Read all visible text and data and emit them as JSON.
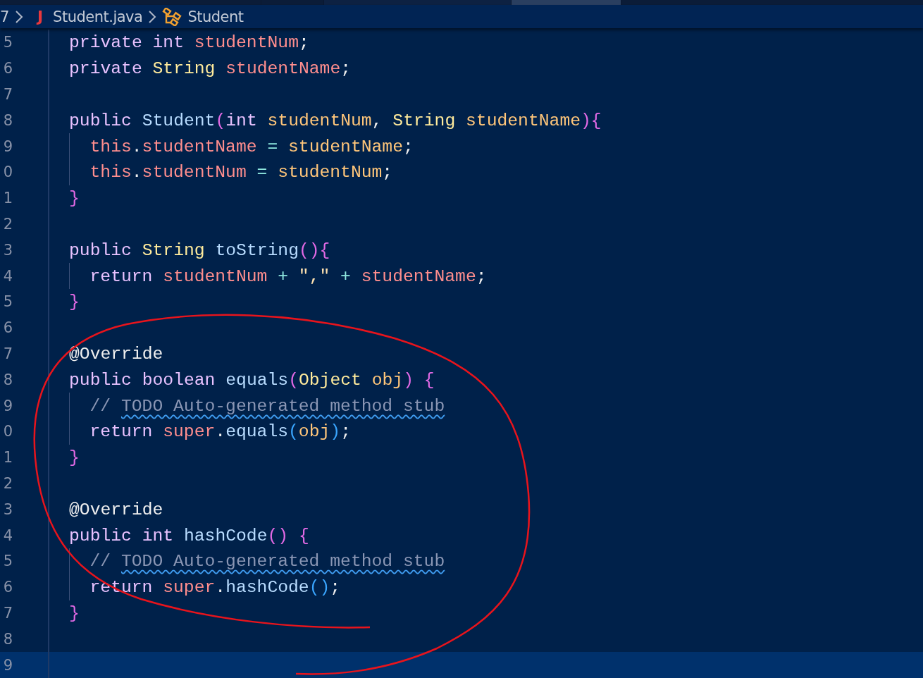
{
  "breadcrumb": {
    "folder": "7",
    "file_badge": "J",
    "file": "Student.java",
    "symbol": "Student"
  },
  "lines": [
    {
      "number": "5",
      "nested": false,
      "current": false,
      "tokens": [
        {
          "kind": "keyword",
          "text": "private "
        },
        {
          "kind": "keyword",
          "text": "int "
        },
        {
          "kind": "field",
          "text": "studentNum"
        },
        {
          "kind": "punct",
          "text": ";"
        }
      ]
    },
    {
      "number": "6",
      "nested": false,
      "current": false,
      "tokens": [
        {
          "kind": "keyword",
          "text": "private "
        },
        {
          "kind": "type",
          "text": "String "
        },
        {
          "kind": "field",
          "text": "studentName"
        },
        {
          "kind": "punct",
          "text": ";"
        }
      ]
    },
    {
      "number": "7",
      "nested": false,
      "current": false
    },
    {
      "number": "8",
      "nested": false,
      "current": false,
      "tokens": [
        {
          "kind": "keyword",
          "text": "public "
        },
        {
          "kind": "method",
          "text": "Student"
        },
        {
          "kind": "bracket",
          "text": "("
        },
        {
          "kind": "keyword",
          "text": "int "
        },
        {
          "kind": "param",
          "text": "studentNum"
        },
        {
          "kind": "punct",
          "text": ", "
        },
        {
          "kind": "type",
          "text": "String "
        },
        {
          "kind": "param",
          "text": "studentName"
        },
        {
          "kind": "bracket",
          "text": "){"
        }
      ]
    },
    {
      "number": "9",
      "nested": true,
      "current": false,
      "tokens": [
        {
          "kind": "this",
          "text": "this"
        },
        {
          "kind": "punct",
          "text": "."
        },
        {
          "kind": "field",
          "text": "studentName"
        },
        {
          "kind": "operator",
          "text": " = "
        },
        {
          "kind": "param",
          "text": "studentName"
        },
        {
          "kind": "punct",
          "text": ";"
        }
      ]
    },
    {
      "number": "0",
      "nested": true,
      "current": false,
      "tokens": [
        {
          "kind": "this",
          "text": "this"
        },
        {
          "kind": "punct",
          "text": "."
        },
        {
          "kind": "field",
          "text": "studentNum"
        },
        {
          "kind": "operator",
          "text": " = "
        },
        {
          "kind": "param",
          "text": "studentNum"
        },
        {
          "kind": "punct",
          "text": ";"
        }
      ]
    },
    {
      "number": "1",
      "nested": false,
      "current": false,
      "tokens": [
        {
          "kind": "bracket",
          "text": "}"
        }
      ]
    },
    {
      "number": "2",
      "nested": false,
      "current": false
    },
    {
      "number": "3",
      "nested": false,
      "current": false,
      "tokens": [
        {
          "kind": "keyword",
          "text": "public "
        },
        {
          "kind": "type",
          "text": "String "
        },
        {
          "kind": "method",
          "text": "toString"
        },
        {
          "kind": "bracket",
          "text": "(){"
        }
      ]
    },
    {
      "number": "4",
      "nested": true,
      "current": false,
      "tokens": [
        {
          "kind": "keyword",
          "text": "return "
        },
        {
          "kind": "field",
          "text": "studentNum"
        },
        {
          "kind": "operator",
          "text": " + "
        },
        {
          "kind": "string",
          "text": "\",\""
        },
        {
          "kind": "operator",
          "text": " + "
        },
        {
          "kind": "field",
          "text": "studentName"
        },
        {
          "kind": "punct",
          "text": ";"
        }
      ]
    },
    {
      "number": "5",
      "nested": false,
      "current": false,
      "tokens": [
        {
          "kind": "bracket",
          "text": "}"
        }
      ]
    },
    {
      "number": "6",
      "nested": false,
      "current": false
    },
    {
      "number": "7",
      "nested": false,
      "current": false,
      "tokens": [
        {
          "kind": "annotation",
          "text": "@Override"
        }
      ]
    },
    {
      "number": "8",
      "nested": false,
      "current": false,
      "tokens": [
        {
          "kind": "keyword",
          "text": "public "
        },
        {
          "kind": "keyword",
          "text": "boolean "
        },
        {
          "kind": "method",
          "text": "equals"
        },
        {
          "kind": "bracket",
          "text": "("
        },
        {
          "kind": "type",
          "text": "Object "
        },
        {
          "kind": "param",
          "text": "obj"
        },
        {
          "kind": "bracket",
          "text": ")"
        },
        {
          "kind": "bracket",
          "text": " {"
        }
      ]
    },
    {
      "number": "9",
      "nested": true,
      "current": false,
      "tokens": [
        {
          "kind": "comment",
          "text": "// "
        },
        {
          "kind": "comment",
          "text": "TODO Auto-generated method stub",
          "squiggle": true
        }
      ]
    },
    {
      "number": "0",
      "nested": true,
      "current": false,
      "tokens": [
        {
          "kind": "keyword",
          "text": "return "
        },
        {
          "kind": "this",
          "text": "super"
        },
        {
          "kind": "punct",
          "text": "."
        },
        {
          "kind": "method",
          "text": "equals"
        },
        {
          "kind": "bracket2",
          "text": "("
        },
        {
          "kind": "param",
          "text": "obj"
        },
        {
          "kind": "bracket2",
          "text": ")"
        },
        {
          "kind": "punct",
          "text": ";"
        }
      ]
    },
    {
      "number": "1",
      "nested": false,
      "current": false,
      "tokens": [
        {
          "kind": "bracket",
          "text": "}"
        }
      ]
    },
    {
      "number": "2",
      "nested": false,
      "current": false
    },
    {
      "number": "3",
      "nested": false,
      "current": false,
      "tokens": [
        {
          "kind": "annotation",
          "text": "@Override"
        }
      ]
    },
    {
      "number": "4",
      "nested": false,
      "current": false,
      "tokens": [
        {
          "kind": "keyword",
          "text": "public "
        },
        {
          "kind": "keyword",
          "text": "int "
        },
        {
          "kind": "method",
          "text": "hashCode"
        },
        {
          "kind": "bracket",
          "text": "()"
        },
        {
          "kind": "bracket",
          "text": " {"
        }
      ]
    },
    {
      "number": "5",
      "nested": true,
      "current": false,
      "tokens": [
        {
          "kind": "comment",
          "text": "// "
        },
        {
          "kind": "comment",
          "text": "TODO Auto-generated method stub",
          "squiggle": true
        }
      ]
    },
    {
      "number": "6",
      "nested": true,
      "current": false,
      "tokens": [
        {
          "kind": "keyword",
          "text": "return "
        },
        {
          "kind": "this",
          "text": "super"
        },
        {
          "kind": "punct",
          "text": "."
        },
        {
          "kind": "method",
          "text": "hashCode"
        },
        {
          "kind": "bracket2",
          "text": "()"
        },
        {
          "kind": "punct",
          "text": ";"
        }
      ]
    },
    {
      "number": "7",
      "nested": false,
      "current": false,
      "tokens": [
        {
          "kind": "bracket",
          "text": "}"
        }
      ]
    },
    {
      "number": "8",
      "nested": false,
      "current": false
    },
    {
      "number": "9",
      "nested": false,
      "current": true
    }
  ]
}
